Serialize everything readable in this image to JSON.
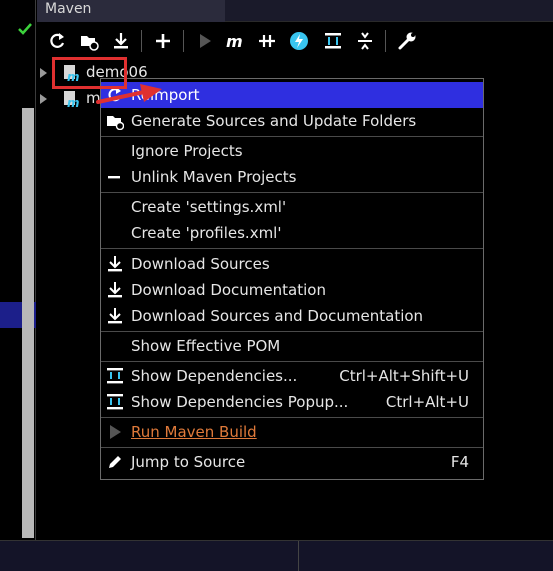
{
  "window": {
    "title": "Maven"
  },
  "tree": [
    {
      "label": "demo06"
    },
    {
      "label": "m"
    }
  ],
  "toolbar": {
    "icons": [
      "refresh-icon",
      "generate-sources-icon",
      "download-icon",
      "add-icon",
      "run-icon",
      "maven-icon",
      "toggle-offline-icon",
      "lightning-icon",
      "show-dependencies-icon",
      "collapse-icon",
      "settings-wrench-icon"
    ]
  },
  "menu": {
    "items": [
      {
        "label": "Reimport",
        "shortcut": ""
      },
      {
        "label": "Generate Sources and Update Folders",
        "shortcut": ""
      },
      {
        "label": "Ignore Projects",
        "shortcut": ""
      },
      {
        "label": "Unlink Maven Projects",
        "shortcut": ""
      },
      {
        "label": "Create 'settings.xml'",
        "shortcut": ""
      },
      {
        "label": "Create 'profiles.xml'",
        "shortcut": ""
      },
      {
        "label": "Download Sources",
        "shortcut": ""
      },
      {
        "label": "Download Documentation",
        "shortcut": ""
      },
      {
        "label": "Download Sources and Documentation",
        "shortcut": ""
      },
      {
        "label": "Show Effective POM",
        "shortcut": ""
      },
      {
        "label": "Show Dependencies...",
        "shortcut": "Ctrl+Alt+Shift+U"
      },
      {
        "label": "Show Dependencies Popup...",
        "shortcut": "Ctrl+Alt+U"
      },
      {
        "label": "Run Maven Build",
        "shortcut": ""
      },
      {
        "label": "Jump to Source",
        "shortcut": "F4"
      }
    ]
  },
  "colors": {
    "selection": "#2f2fe0",
    "annotation": "#e03030",
    "run_link": "#e07a3a",
    "maven_cyan": "#39c5f0"
  }
}
